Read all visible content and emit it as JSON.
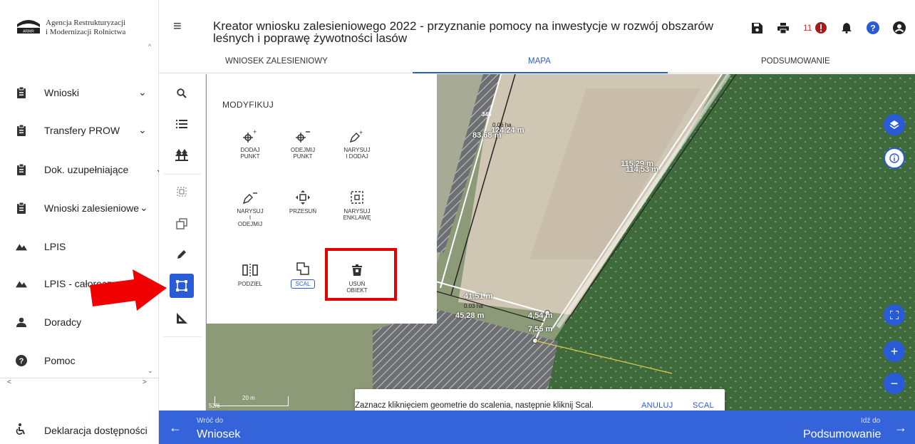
{
  "brand": {
    "line1": "Agencja Restrukturyzacji",
    "line2": "i Modernizacji Rolnictwa",
    "mark": "ARiMR"
  },
  "header": {
    "title_line1": "Kreator wniosku zalesieniowego 2022 - przyznanie pomocy na inwestycje w rozwój obszarów",
    "title_line2": "leśnych i poprawę żywotności lasów",
    "notif_count": "11"
  },
  "tabs": [
    {
      "label": "WNIOSEK ZALESIENIOWY"
    },
    {
      "label": "MAPA"
    },
    {
      "label": "PODSUMOWANIE"
    }
  ],
  "sidebar": {
    "items": [
      {
        "label": "Wnioski",
        "icon": "clipboard-icon"
      },
      {
        "label": "Transfery PROW",
        "icon": "clipboard-icon"
      },
      {
        "label": "Dok. uzupełniające",
        "icon": "clipboard-icon"
      },
      {
        "label": "Wnioski zalesieniowe",
        "icon": "clipboard-icon"
      },
      {
        "label": "LPIS",
        "icon": "terrain-icon"
      },
      {
        "label": "LPIS - całoroczny",
        "icon": "terrain-icon"
      },
      {
        "label": "Doradcy",
        "icon": "person-icon"
      },
      {
        "label": "Pomoc",
        "icon": "help-icon"
      }
    ],
    "accessibility": "Deklaracja dostępności"
  },
  "panel": {
    "title": "MODYFIKUJ",
    "tools": [
      {
        "label1": "DODAJ",
        "label2": "PUNKT"
      },
      {
        "label1": "ODEJMIJ",
        "label2": "PUNKT"
      },
      {
        "label1": "NARYSUJ",
        "label2": "I DODAJ"
      },
      {
        "label1": "NARYSUJ",
        "label2": "I",
        "label3": "ODEJMIJ"
      },
      {
        "label1": "PRZESUŃ",
        "label2": ""
      },
      {
        "label1": "NARYSUJ",
        "label2": "ENKLAWĘ"
      },
      {
        "label1": "PODZIEL",
        "label2": ""
      },
      {
        "label1": "SCAL",
        "label2": ""
      },
      {
        "label1": "USUŃ",
        "label2": "OBIEKT"
      }
    ]
  },
  "map": {
    "labels": {
      "parcel_345": "345",
      "area_006": "0.06 ha",
      "len_8368": "83,68 m",
      "len_12424": "124,24 m",
      "len_11529": "115,29 m",
      "len_11453": "114,53 m",
      "len_4151": "41,51 m",
      "area_003": "0.03 ha",
      "len_4528": "45,28 m",
      "len_454": "4,54 m",
      "len_755": "7,55 m"
    },
    "scale": "20 m",
    "parcel": "52/6"
  },
  "snackbar": {
    "message": "Zaznacz kliknięciem geometrie do scalenia, następnie kliknij Scal.",
    "cancel": "ANULUJ",
    "confirm": "SCAL"
  },
  "bottom": {
    "back_small": "Wróć do",
    "back_big": "Wniosek",
    "next_small": "Idź do",
    "next_big": "Podsumowanie"
  },
  "colors": {
    "accent": "#2a5bd6",
    "bottom_bar": "#3563d9",
    "highlight": "#e30000",
    "forest": "#3f6b3c"
  }
}
